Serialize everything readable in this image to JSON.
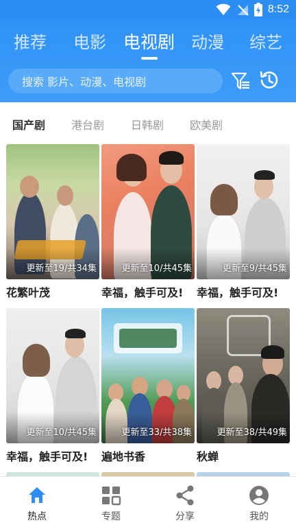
{
  "status_bar": {
    "time": "8:52"
  },
  "colors": {
    "brand": "#2c8df3",
    "active_nav": "#2c8df3",
    "inactive_nav": "#777777"
  },
  "top_tabs": [
    {
      "label": "推荐",
      "active": false
    },
    {
      "label": "电影",
      "active": false
    },
    {
      "label": "电视剧",
      "active": true
    },
    {
      "label": "动漫",
      "active": false
    },
    {
      "label": "综艺",
      "active": false
    }
  ],
  "search": {
    "placeholder": "搜索 影片、动漫、电视剧"
  },
  "icons": {
    "filter": "filter-icon",
    "history": "history-clock-icon"
  },
  "sub_tabs": [
    {
      "label": "国产剧",
      "active": true
    },
    {
      "label": "港台剧",
      "active": false
    },
    {
      "label": "日韩剧",
      "active": false
    },
    {
      "label": "欧美剧",
      "active": false
    }
  ],
  "cards": [
    {
      "title": "花繁叶茂",
      "badge": "更新至19/共34集"
    },
    {
      "title": "幸福，触手可及!",
      "badge": "更新至10/共45集"
    },
    {
      "title": "幸福，触手可及!",
      "badge": "更新至9/共45集"
    },
    {
      "title": "幸福，触手可及!",
      "badge": "更新至10/共45集"
    },
    {
      "title": "遍地书香",
      "badge": "更新至33/共38集"
    },
    {
      "title": "秋蝉",
      "badge": "更新至38/共49集"
    }
  ],
  "bottom_nav": [
    {
      "label": "热点",
      "icon": "home-icon",
      "active": true
    },
    {
      "label": "专题",
      "icon": "grid-icon",
      "active": false
    },
    {
      "label": "分享",
      "icon": "share-icon",
      "active": false
    },
    {
      "label": "我的",
      "icon": "user-icon",
      "active": false
    }
  ]
}
